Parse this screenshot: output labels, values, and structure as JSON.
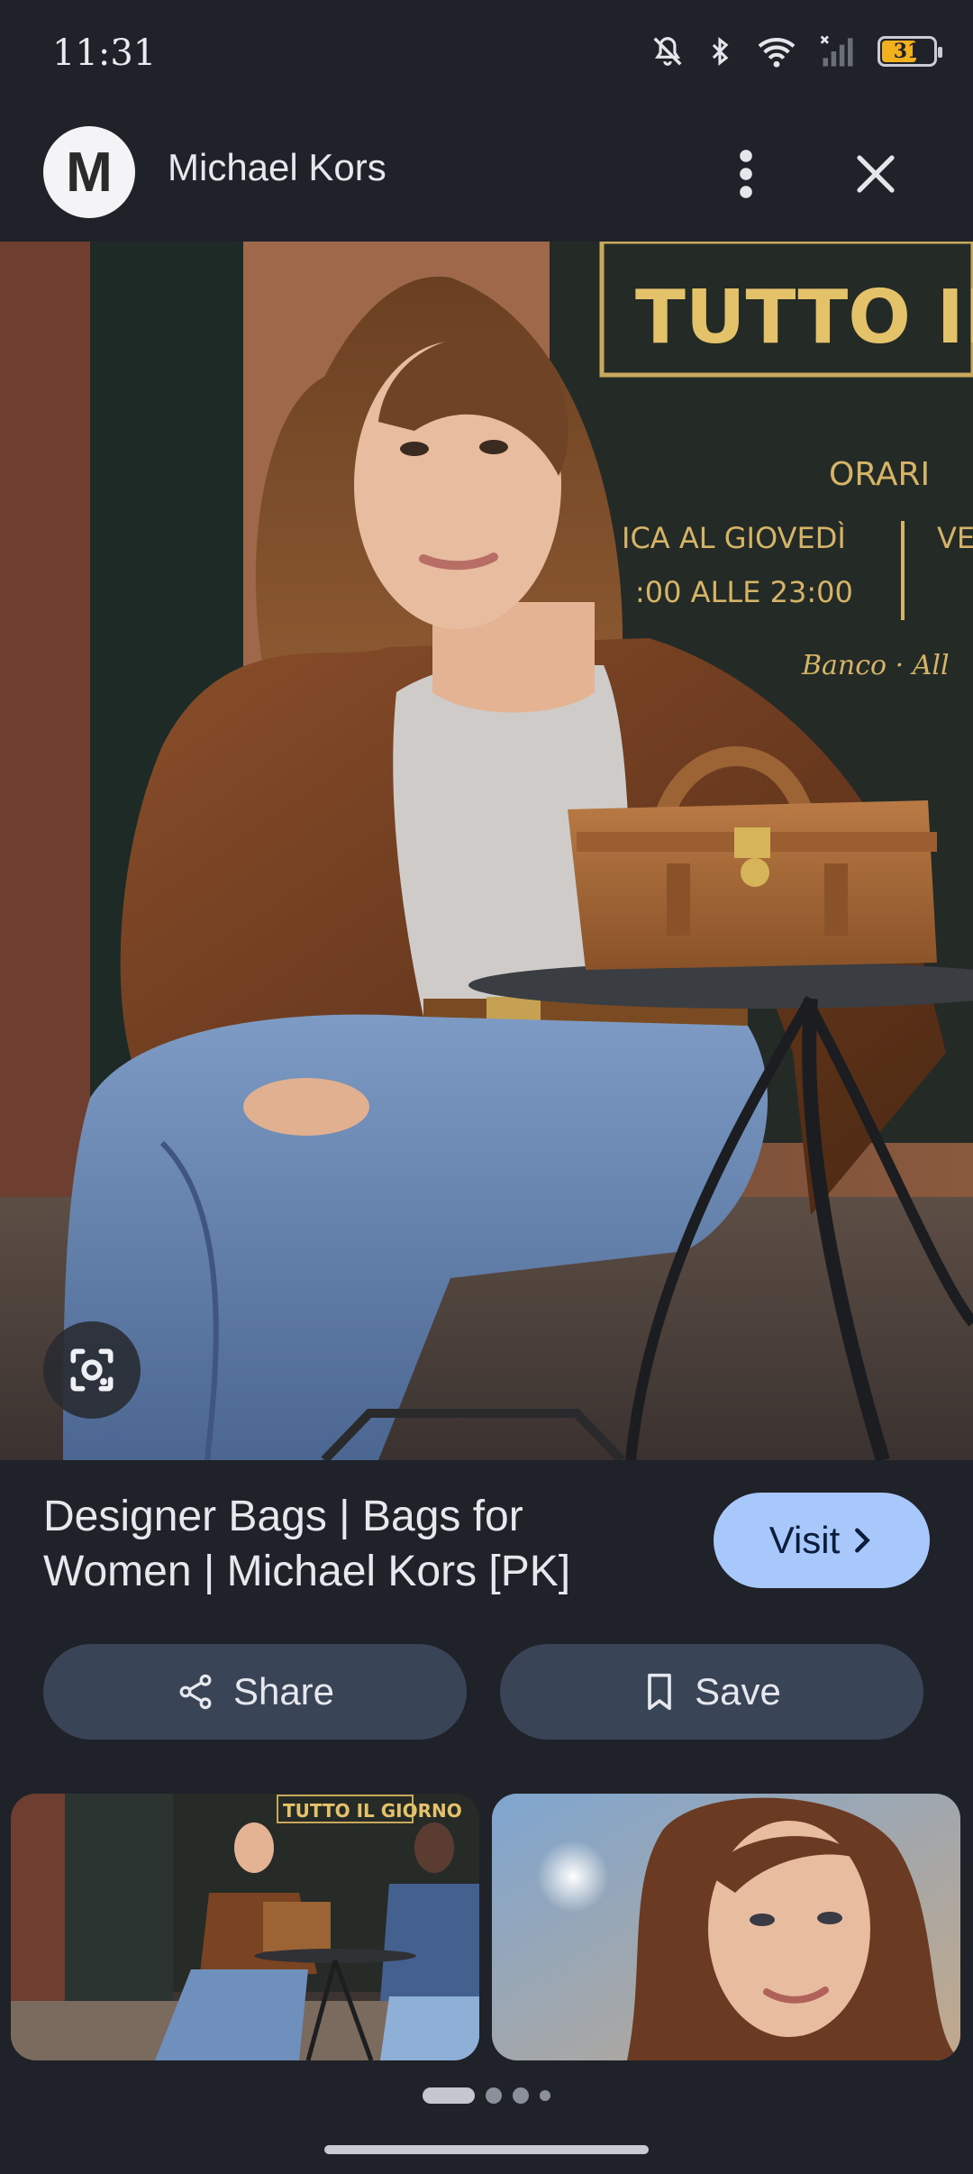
{
  "status_bar": {
    "time": "11:31",
    "battery_level": "31",
    "icons": [
      "mute-icon",
      "bluetooth-icon",
      "wifi-icon",
      "signal-icon",
      "battery-icon"
    ]
  },
  "header": {
    "avatar_letter": "M",
    "site_name": "Michael Kors"
  },
  "main_image": {
    "sign_text_1": "TUTTO IL GI",
    "sign_text_2": "ORARI",
    "sign_text_3": "ICA AL GIOVEDÌ",
    "sign_text_4": "VE",
    "sign_text_5": ":00 ALLE 23:00",
    "sign_text_6": "Banco · All"
  },
  "result": {
    "title": "Designer Bags | Bags for Women | Michael Kors [PK]",
    "visit_label": "Visit"
  },
  "actions": {
    "share_label": "Share",
    "save_label": "Save"
  },
  "thumbnails": {
    "thumb1_sign": "TUTTO IL GIORNO"
  },
  "colors": {
    "background": "#1f2229",
    "visit_button": "#a8c7fa",
    "action_button": "#394457"
  }
}
